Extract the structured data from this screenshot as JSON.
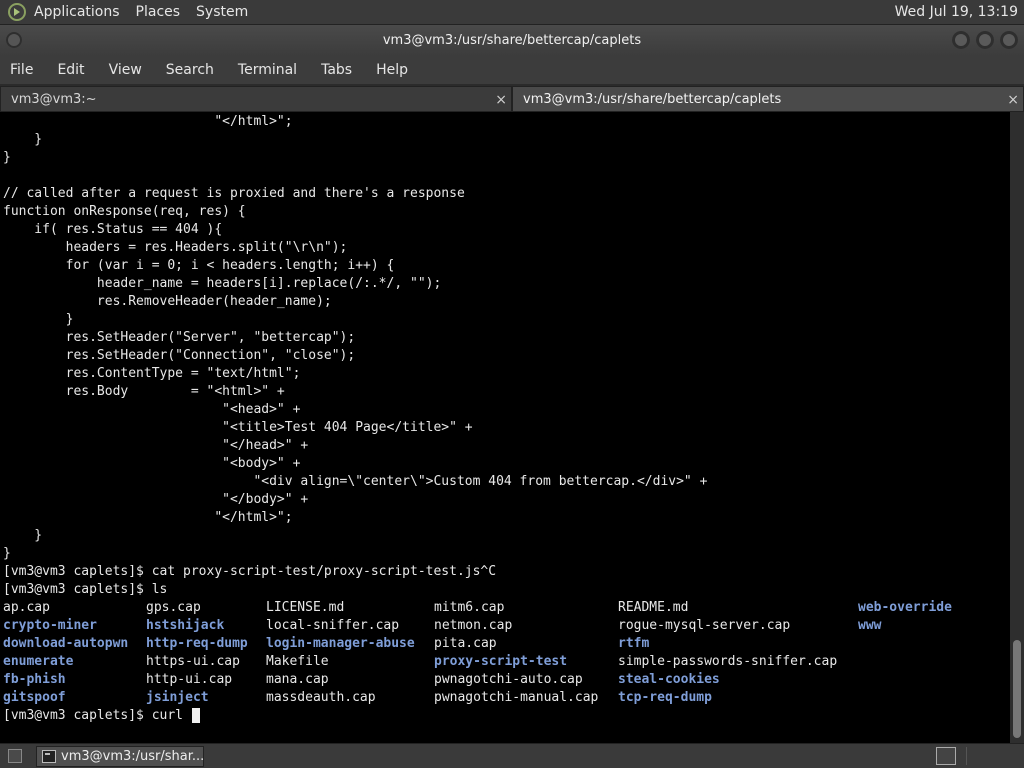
{
  "topbar": {
    "menus": [
      "Applications",
      "Places",
      "System"
    ],
    "clock": "Wed Jul 19, 13:19"
  },
  "window": {
    "title": "vm3@vm3:/usr/share/bettercap/caplets"
  },
  "menubar": [
    "File",
    "Edit",
    "View",
    "Search",
    "Terminal",
    "Tabs",
    "Help"
  ],
  "tabs": [
    {
      "label": "vm3@vm3:~",
      "close": "×"
    },
    {
      "label": "vm3@vm3:/usr/share/bettercap/caplets",
      "close": "×"
    }
  ],
  "terminal": {
    "lines": [
      "                           \"</html>\";",
      "    }",
      "}",
      "",
      "// called after a request is proxied and there's a response",
      "function onResponse(req, res) {",
      "    if( res.Status == 404 ){",
      "        headers = res.Headers.split(\"\\r\\n\");",
      "        for (var i = 0; i < headers.length; i++) {",
      "            header_name = headers[i].replace(/:.*/, \"\");",
      "            res.RemoveHeader(header_name);",
      "        }",
      "        res.SetHeader(\"Server\", \"bettercap\");",
      "        res.SetHeader(\"Connection\", \"close\");",
      "        res.ContentType = \"text/html\";",
      "        res.Body        = \"<html>\" +",
      "                            \"<head>\" +",
      "                            \"<title>Test 404 Page</title>\" +",
      "                            \"</head>\" +",
      "                            \"<body>\" +",
      "                                \"<div align=\\\"center\\\">Custom 404 from bettercap.</div>\" +",
      "                            \"</body>\" +",
      "                           \"</html>\";",
      "    }",
      "}",
      "[vm3@vm3 caplets]$ cat proxy-script-test/proxy-script-test.js^C",
      "[vm3@vm3 caplets]$ ls"
    ],
    "ls_columns": [
      [
        {
          "name": "ap.cap",
          "dir": false
        },
        {
          "name": "crypto-miner",
          "dir": true
        },
        {
          "name": "download-autopwn",
          "dir": true
        },
        {
          "name": "enumerate",
          "dir": true
        },
        {
          "name": "fb-phish",
          "dir": true
        },
        {
          "name": "gitspoof",
          "dir": true
        }
      ],
      [
        {
          "name": "gps.cap",
          "dir": false
        },
        {
          "name": "hstshijack",
          "dir": true
        },
        {
          "name": "http-req-dump",
          "dir": true
        },
        {
          "name": "https-ui.cap",
          "dir": false
        },
        {
          "name": "http-ui.cap",
          "dir": false
        },
        {
          "name": "jsinject",
          "dir": true
        }
      ],
      [
        {
          "name": "LICENSE.md",
          "dir": false
        },
        {
          "name": "local-sniffer.cap",
          "dir": false
        },
        {
          "name": "login-manager-abuse",
          "dir": true
        },
        {
          "name": "Makefile",
          "dir": false
        },
        {
          "name": "mana.cap",
          "dir": false
        },
        {
          "name": "massdeauth.cap",
          "dir": false
        }
      ],
      [
        {
          "name": "mitm6.cap",
          "dir": false
        },
        {
          "name": "netmon.cap",
          "dir": false
        },
        {
          "name": "pita.cap",
          "dir": false
        },
        {
          "name": "proxy-script-test",
          "dir": true
        },
        {
          "name": "pwnagotchi-auto.cap",
          "dir": false
        },
        {
          "name": "pwnagotchi-manual.cap",
          "dir": false
        }
      ],
      [
        {
          "name": "README.md",
          "dir": false
        },
        {
          "name": "rogue-mysql-server.cap",
          "dir": false
        },
        {
          "name": "rtfm",
          "dir": true
        },
        {
          "name": "simple-passwords-sniffer.cap",
          "dir": false
        },
        {
          "name": "steal-cookies",
          "dir": true
        },
        {
          "name": "tcp-req-dump",
          "dir": true
        }
      ],
      [
        {
          "name": "web-override",
          "dir": true
        },
        {
          "name": "www",
          "dir": true
        }
      ]
    ],
    "prompt": "[vm3@vm3 caplets]$ curl "
  },
  "taskbar": {
    "item_label": "vm3@vm3:/usr/shar..."
  }
}
